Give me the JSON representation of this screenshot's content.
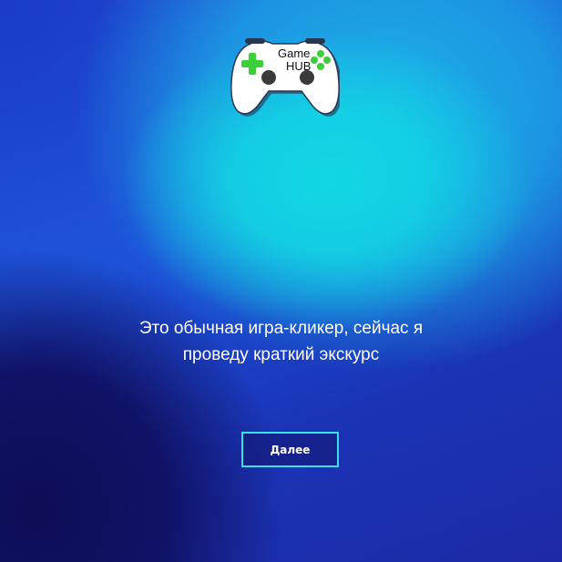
{
  "logo": {
    "line1": "Game",
    "line2": "HUB",
    "icon": "gamepad-icon"
  },
  "intro": {
    "line1": "Это обычная игра-кликер, сейчас я",
    "line2": "проведу краткий экскурс"
  },
  "next_button": {
    "label": "Далее"
  },
  "colors": {
    "button_border": "#38e0ec",
    "text": "#ffffff",
    "accent_green": "#3ccf3a"
  }
}
